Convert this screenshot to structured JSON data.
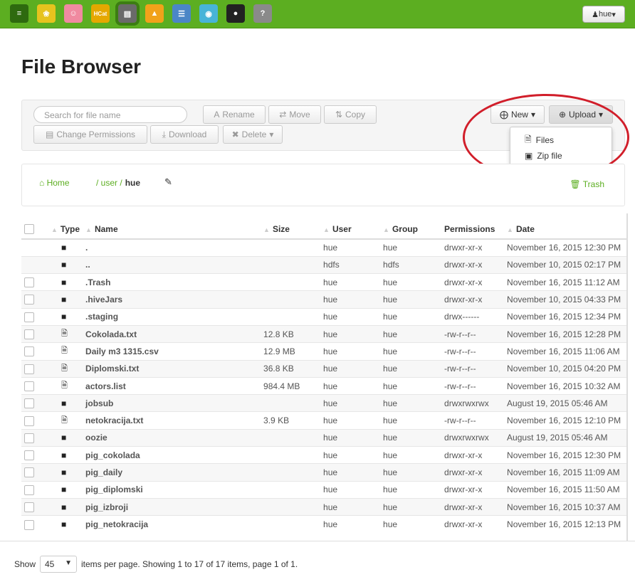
{
  "topbar": {
    "apps": [
      {
        "icon": "hue-logo-icon",
        "symbol": "≡",
        "color": "#2e6a0f"
      },
      {
        "icon": "hive-bee-icon",
        "symbol": "❀",
        "color": "#e6c31e"
      },
      {
        "icon": "pig-icon",
        "symbol": "☺",
        "color": "#f08aa0"
      },
      {
        "icon": "hcat-icon",
        "symbol": "HCat",
        "color": "#e5a800"
      },
      {
        "icon": "file-browser-icon",
        "symbol": "▤",
        "color": "#6a6a6a"
      },
      {
        "icon": "job-designer-icon",
        "symbol": "▲",
        "color": "#f1a21a"
      },
      {
        "icon": "job-browser-icon",
        "symbol": "☰",
        "color": "#4b86c6"
      },
      {
        "icon": "oozie-icon",
        "symbol": "◉",
        "color": "#48b4d8"
      },
      {
        "icon": "user-admin-icon",
        "symbol": "●",
        "color": "#222222"
      },
      {
        "icon": "help-icon",
        "symbol": "?",
        "color": "#8a8a8a"
      }
    ],
    "user_button": "hue"
  },
  "page_title": "File Browser",
  "toolbar": {
    "search_placeholder": "Search for file name",
    "rename": "Rename",
    "move": "Move",
    "copy": "Copy",
    "change_permissions": "Change Permissions",
    "download": "Download",
    "delete": "Delete",
    "new": "New",
    "upload": "Upload"
  },
  "upload_menu": {
    "files": "Files",
    "zip": "Zip file"
  },
  "breadcrumb": {
    "home": "Home",
    "path_prefix": "/ user /",
    "current": "hue",
    "trash": "Trash"
  },
  "table": {
    "headers": {
      "type": "Type",
      "name": "Name",
      "size": "Size",
      "user": "User",
      "group": "Group",
      "permissions": "Permissions",
      "date": "Date"
    },
    "rows": [
      {
        "kind": "folder",
        "checkbox": false,
        "name": ".",
        "size": "",
        "user": "hue",
        "group": "hue",
        "perm": "drwxr-xr-x",
        "date": "November 16, 2015 12:30 PM"
      },
      {
        "kind": "folder",
        "checkbox": false,
        "name": "..",
        "size": "",
        "user": "hdfs",
        "group": "hdfs",
        "perm": "drwxr-xr-x",
        "date": "November 10, 2015 02:17 PM"
      },
      {
        "kind": "folder",
        "checkbox": true,
        "name": ".Trash",
        "size": "",
        "user": "hue",
        "group": "hue",
        "perm": "drwxr-xr-x",
        "date": "November 16, 2015 11:12 AM"
      },
      {
        "kind": "folder",
        "checkbox": true,
        "name": ".hiveJars",
        "size": "",
        "user": "hue",
        "group": "hue",
        "perm": "drwxr-xr-x",
        "date": "November 10, 2015 04:33 PM"
      },
      {
        "kind": "folder",
        "checkbox": true,
        "name": ".staging",
        "size": "",
        "user": "hue",
        "group": "hue",
        "perm": "drwx------",
        "date": "November 16, 2015 12:34 PM"
      },
      {
        "kind": "file",
        "checkbox": true,
        "name": "Cokolada.txt",
        "size": "12.8 KB",
        "user": "hue",
        "group": "hue",
        "perm": "-rw-r--r--",
        "date": "November 16, 2015 12:28 PM"
      },
      {
        "kind": "file",
        "checkbox": true,
        "name": "Daily m3 1315.csv",
        "size": "12.9 MB",
        "user": "hue",
        "group": "hue",
        "perm": "-rw-r--r--",
        "date": "November 16, 2015 11:06 AM"
      },
      {
        "kind": "file",
        "checkbox": true,
        "name": "Diplomski.txt",
        "size": "36.8 KB",
        "user": "hue",
        "group": "hue",
        "perm": "-rw-r--r--",
        "date": "November 10, 2015 04:20 PM"
      },
      {
        "kind": "file",
        "checkbox": true,
        "name": "actors.list",
        "size": "984.4 MB",
        "user": "hue",
        "group": "hue",
        "perm": "-rw-r--r--",
        "date": "November 16, 2015 10:32 AM"
      },
      {
        "kind": "folder",
        "checkbox": true,
        "name": "jobsub",
        "size": "",
        "user": "hue",
        "group": "hue",
        "perm": "drwxrwxrwx",
        "date": "August 19, 2015 05:46 AM"
      },
      {
        "kind": "file",
        "checkbox": true,
        "name": "netokracija.txt",
        "size": "3.9 KB",
        "user": "hue",
        "group": "hue",
        "perm": "-rw-r--r--",
        "date": "November 16, 2015 12:10 PM"
      },
      {
        "kind": "folder",
        "checkbox": true,
        "name": "oozie",
        "size": "",
        "user": "hue",
        "group": "hue",
        "perm": "drwxrwxrwx",
        "date": "August 19, 2015 05:46 AM"
      },
      {
        "kind": "folder",
        "checkbox": true,
        "name": "pig_cokolada",
        "size": "",
        "user": "hue",
        "group": "hue",
        "perm": "drwxr-xr-x",
        "date": "November 16, 2015 12:30 PM"
      },
      {
        "kind": "folder",
        "checkbox": true,
        "name": "pig_daily",
        "size": "",
        "user": "hue",
        "group": "hue",
        "perm": "drwxr-xr-x",
        "date": "November 16, 2015 11:09 AM"
      },
      {
        "kind": "folder",
        "checkbox": true,
        "name": "pig_diplomski",
        "size": "",
        "user": "hue",
        "group": "hue",
        "perm": "drwxr-xr-x",
        "date": "November 16, 2015 11:50 AM"
      },
      {
        "kind": "folder",
        "checkbox": true,
        "name": "pig_izbroji",
        "size": "",
        "user": "hue",
        "group": "hue",
        "perm": "drwxr-xr-x",
        "date": "November 16, 2015 10:37 AM"
      },
      {
        "kind": "folder",
        "checkbox": true,
        "name": "pig_netokracija",
        "size": "",
        "user": "hue",
        "group": "hue",
        "perm": "drwxr-xr-x",
        "date": "November 16, 2015 12:13 PM"
      }
    ]
  },
  "footer": {
    "show": "Show",
    "per_page_value": "45",
    "summary": "items per page. Showing 1 to 17 of 17 items, page 1 of 1."
  }
}
